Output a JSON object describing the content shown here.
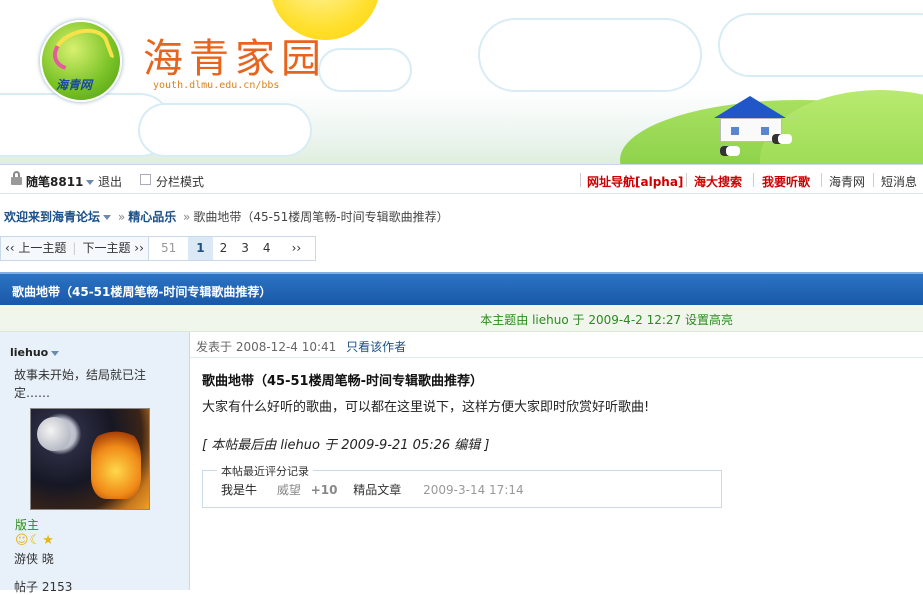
{
  "header": {
    "site_title": "海青家园",
    "site_url": "youth.dlmu.edu.cn/bbs",
    "logo_text": "海青网"
  },
  "userbar": {
    "username": "随笔8811",
    "logout": "退出",
    "split_mode": "分栏模式",
    "links": [
      {
        "label": "网址导航[alpha]",
        "color": "#cc0000"
      },
      {
        "label": "海大搜索",
        "color": "#cc0000"
      },
      {
        "label": "我要听歌",
        "color": "#cc0000"
      },
      {
        "label": "海青网",
        "color": "#333333"
      },
      {
        "label": "短消息",
        "color": "#333333"
      }
    ]
  },
  "breadcrumb": {
    "home": "欢迎来到海青论坛",
    "forum": "精心品乐",
    "current": "歌曲地带（45-51楼周笔畅-时间专辑歌曲推荐）"
  },
  "nav": {
    "prev": "‹‹ 上一主题",
    "next": "下一主题 ››",
    "pages": [
      "51",
      "1",
      "2",
      "3",
      "4",
      "››"
    ],
    "current_page": "1"
  },
  "topic": {
    "title": "歌曲地带（45-51楼周笔畅-时间专辑歌曲推荐）",
    "highlight_note": "本主题由  liehuo 于  2009-4-2 12:27 设置高亮"
  },
  "author": {
    "name": "liehuo",
    "signature": "故事未开始，结局就已注定……",
    "rank": "版主",
    "level": "游侠  晓",
    "posts": "帖子  2153",
    "medals": "☺☾★"
  },
  "post": {
    "posted_at": "发表于  2008-12-4 10:41",
    "only_author": "只看该作者",
    "title": "歌曲地带（45-51楼周笔畅-时间专辑歌曲推荐）",
    "body": "大家有什么好听的歌曲，可以都在这里说下，这样方便大家即时欣赏好听歌曲!",
    "edit_note": "[ 本帖最后由  liehuo  于  2009-9-21 05:26 编辑  ]",
    "ratings_legend": "本帖最近评分记录",
    "rating": {
      "user": "我是牛",
      "field": "威望",
      "value": "+10",
      "reason": "精品文章",
      "time": "2009-3-14 17:14"
    }
  }
}
